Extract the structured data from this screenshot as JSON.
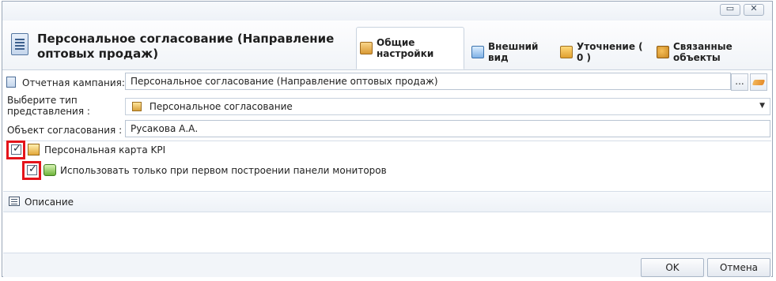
{
  "header": {
    "title": "Персональное согласование (Направление оптовых продаж)",
    "tabs": [
      {
        "label": "Общие настройки",
        "icon": "settings-icon",
        "active": true
      },
      {
        "label": "Внешний вид",
        "icon": "view-icon",
        "active": false
      },
      {
        "label": "Уточнение ( 0 )",
        "icon": "filter-icon",
        "active": false
      },
      {
        "label": "Связанные объекты",
        "icon": "linked-objects-icon",
        "active": false
      }
    ]
  },
  "form": {
    "campaign_label": "Отчетная кампания:",
    "campaign_value": "Персональное согласование (Направление оптовых продаж)",
    "browse_label": "...",
    "view_type_label": "Выберите тип представления :",
    "view_type_value": "Персональное согласование",
    "object_label": "Объект согласования :",
    "object_value": "Русакова А.А.",
    "kpi_label": "Персональная карта KPI",
    "kpi_checked": true,
    "first_build_label": "Использовать только при первом построении панели мониторов",
    "first_build_checked": true
  },
  "description": {
    "label": "Описание"
  },
  "footer": {
    "ok_label": "OK",
    "cancel_label": "Отмена"
  },
  "colors": {
    "highlight": "#e4141b",
    "border": "#b9c4d2"
  }
}
